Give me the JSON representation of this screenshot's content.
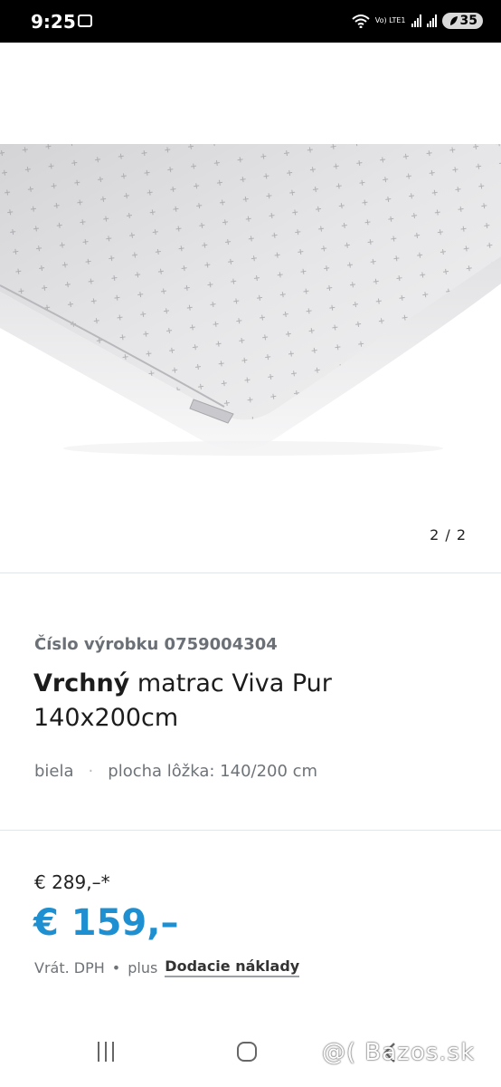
{
  "status_bar": {
    "time": "9:25",
    "network": "Vo) LTE1",
    "battery": "35"
  },
  "gallery": {
    "counter": "2 / 2"
  },
  "product": {
    "code_line": "Číslo výrobku 0759004304",
    "title_bold": "Vrchný",
    "title_rest": " matrac Viva Pur 140x200cm",
    "attr_color": "biela",
    "attr_separator": "·",
    "attr_size": "plocha lôžka: 140/200 cm"
  },
  "pricing": {
    "old_price": "€ 289,–*",
    "new_price": "€ 159,–",
    "vat_text": "Vrát. DPH",
    "bullet": "•",
    "plus_text": "plus",
    "shipping_link": "Dodacie náklady",
    "accent_color": "#1e8fd0"
  },
  "watermark": "@( Bazos.sk"
}
